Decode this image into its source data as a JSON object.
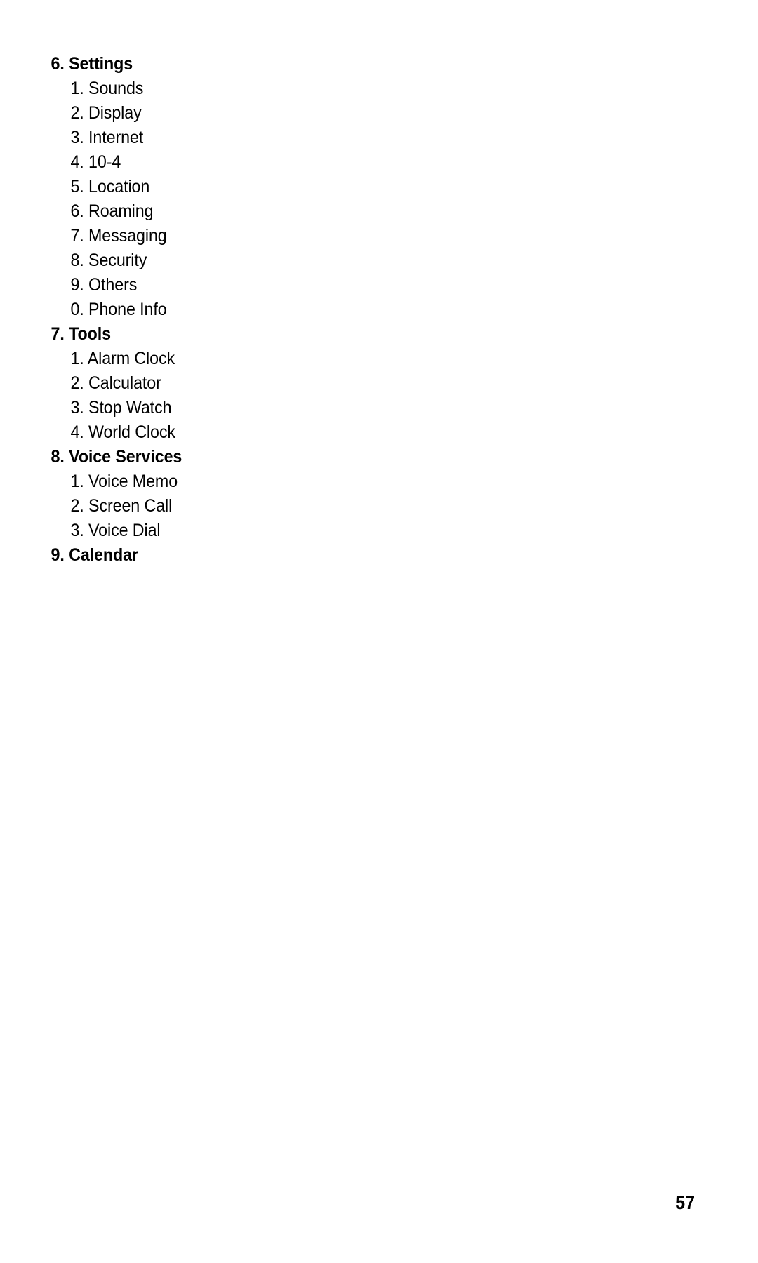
{
  "document": {
    "page_number": "57",
    "outline": [
      {
        "number": "6.",
        "title": "Settings",
        "items": [
          {
            "number": "1.",
            "label": "Sounds"
          },
          {
            "number": "2.",
            "label": "Display"
          },
          {
            "number": "3.",
            "label": "Internet"
          },
          {
            "number": "4.",
            "label": "10-4"
          },
          {
            "number": "5.",
            "label": "Location"
          },
          {
            "number": "6.",
            "label": "Roaming"
          },
          {
            "number": "7.",
            "label": "Messaging"
          },
          {
            "number": "8.",
            "label": "Security"
          },
          {
            "number": "9.",
            "label": "Others"
          },
          {
            "number": "0.",
            "label": "Phone Info"
          }
        ]
      },
      {
        "number": "7.",
        "title": "Tools",
        "items": [
          {
            "number": "1.",
            "label": "Alarm Clock"
          },
          {
            "number": "2.",
            "label": "Calculator"
          },
          {
            "number": "3.",
            "label": "Stop Watch"
          },
          {
            "number": "4.",
            "label": "World Clock"
          }
        ]
      },
      {
        "number": "8.",
        "title": "Voice Services",
        "items": [
          {
            "number": "1.",
            "label": "Voice Memo"
          },
          {
            "number": "2.",
            "label": "Screen Call"
          },
          {
            "number": "3.",
            "label": "Voice Dial"
          }
        ]
      },
      {
        "number": "9.",
        "title": "Calendar",
        "items": []
      }
    ]
  }
}
